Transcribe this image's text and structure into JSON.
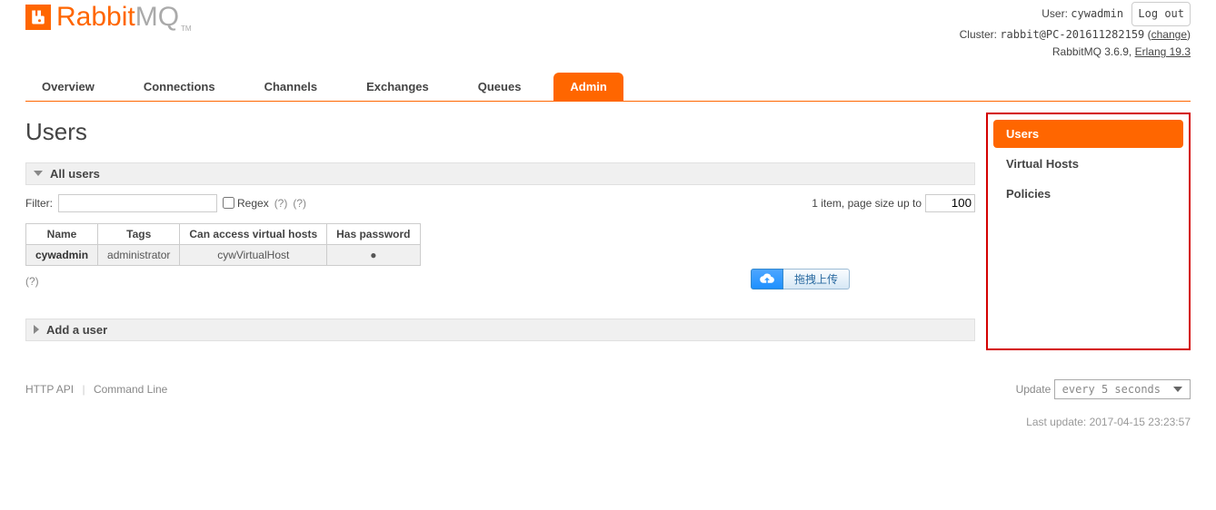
{
  "brand": {
    "rabbit": "Rabbit",
    "mq": "MQ",
    "tm": "TM"
  },
  "header": {
    "user_label": "User:",
    "user_name": "cywadmin",
    "logout": "Log out",
    "cluster_label": "Cluster:",
    "cluster_name": "rabbit@PC-201611282159",
    "change": "change",
    "version_line": "RabbitMQ 3.6.9, ",
    "erlang": "Erlang 19.3"
  },
  "nav": {
    "tabs": [
      {
        "label": "Overview",
        "active": false
      },
      {
        "label": "Connections",
        "active": false
      },
      {
        "label": "Channels",
        "active": false
      },
      {
        "label": "Exchanges",
        "active": false
      },
      {
        "label": "Queues",
        "active": false
      },
      {
        "label": "Admin",
        "active": true
      }
    ]
  },
  "page_title": "Users",
  "sections": {
    "all_users": {
      "title": "All users",
      "expanded": true
    },
    "add_user": {
      "title": "Add a user",
      "expanded": false
    }
  },
  "filter": {
    "label": "Filter:",
    "value": "",
    "regex_label": "Regex",
    "help1": "(?)",
    "help2": "(?)",
    "item_count_text": "1 item, page size up to",
    "page_size": "100"
  },
  "table": {
    "headers": [
      "Name",
      "Tags",
      "Can access virtual hosts",
      "Has password"
    ],
    "rows": [
      {
        "name": "cywadmin",
        "tags": "administrator",
        "vhosts": "cywVirtualHost",
        "has_password": "●"
      }
    ]
  },
  "below_table_help": "(?)",
  "sidebar": {
    "items": [
      {
        "label": "Users",
        "active": true
      },
      {
        "label": "Virtual Hosts",
        "active": false
      },
      {
        "label": "Policies",
        "active": false
      }
    ]
  },
  "footer": {
    "http_api": "HTTP API",
    "cmd": "Command Line",
    "update_label": "Update",
    "update_value": "every 5 seconds",
    "last_update_label": "Last update:",
    "last_update_value": "2017-04-15 23:23:57"
  },
  "upload_widget": {
    "text": "拖拽上传"
  }
}
